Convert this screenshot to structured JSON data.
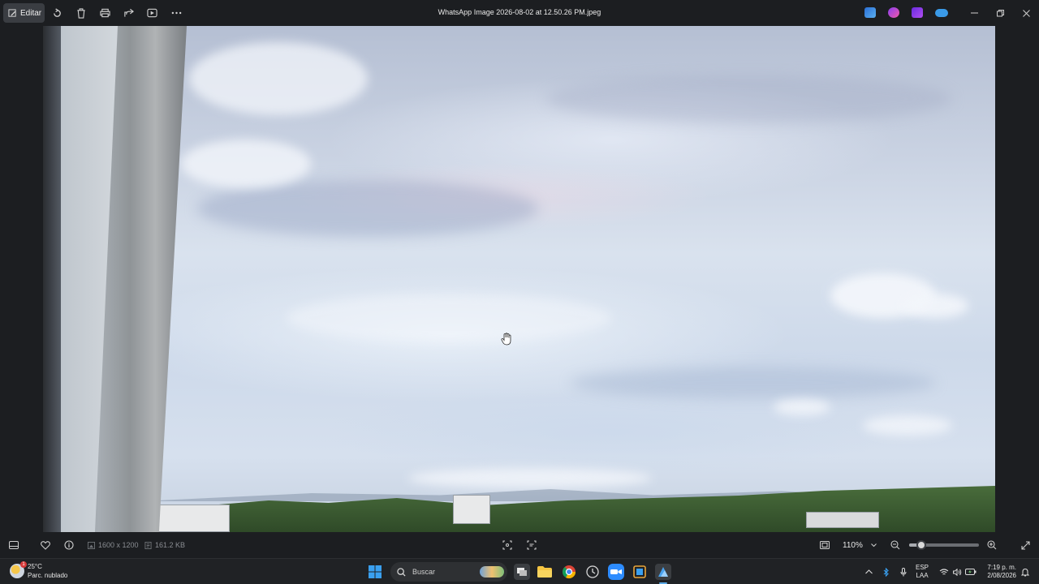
{
  "window": {
    "title": "WhatsApp Image 2026-08-02 at 12.50.26 PM.jpeg",
    "edit_label": "Editar"
  },
  "toolbar": {
    "icons": [
      "edit-icon",
      "rotate-icon",
      "delete-icon",
      "print-icon",
      "share-icon",
      "slideshow-icon",
      "more-icon"
    ]
  },
  "photo_info": {
    "dimensions": "1600 x 1200",
    "file_size": "161.2 KB"
  },
  "zoom": {
    "level": "110%",
    "fraction": 0.17
  },
  "taskbar": {
    "weather_temp": "25°C",
    "weather_desc": "Parc. nublado",
    "weather_badge": "1",
    "search_placeholder": "Buscar",
    "lang_line1": "ESP",
    "lang_line2": "LAA",
    "time": "7:19 p. m.",
    "date": "2/08/2026"
  },
  "colors": {
    "accent": "#5aa9e6",
    "titlebar": "#1c1e21",
    "taskbar": "#202225"
  }
}
